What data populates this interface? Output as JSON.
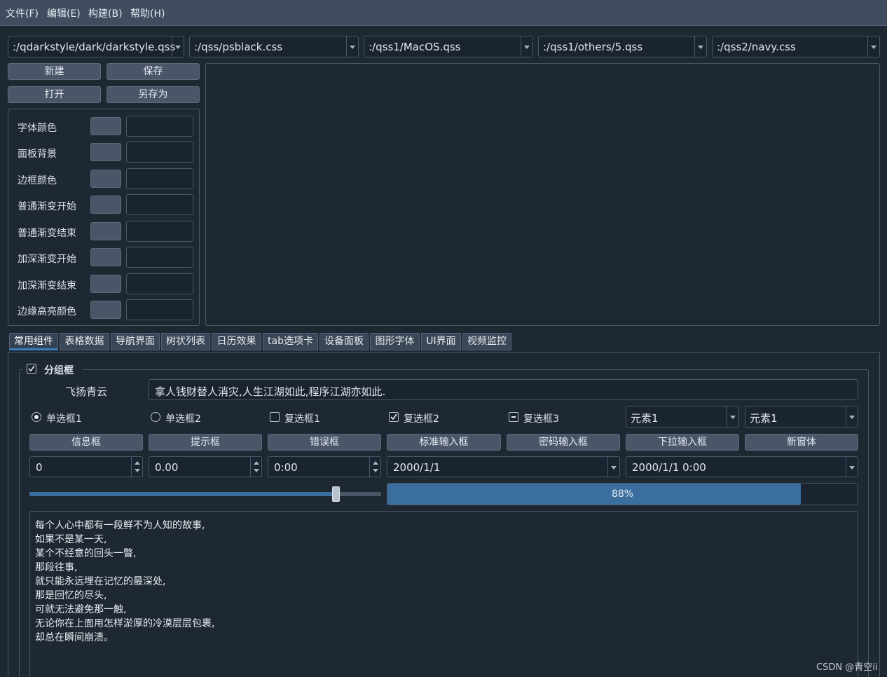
{
  "menu": [
    "文件(F)",
    "编辑(E)",
    "构建(B)",
    "帮助(H)"
  ],
  "style_combos": [
    ":/qdarkstyle/dark/darkstyle.qss",
    ":/qss/psblack.css",
    ":/qss1/MacOS.qss",
    ":/qss1/others/5.qss",
    ":/qss2/navy.css"
  ],
  "file_buttons": {
    "new": "新建",
    "save": "保存",
    "open": "打开",
    "save_as": "另存为"
  },
  "color_rows": [
    "字体颜色",
    "面板背景",
    "边框颜色",
    "普通渐变开始",
    "普通渐变结束",
    "加深渐变开始",
    "加深渐变结束",
    "边缘高亮颜色"
  ],
  "tabs": [
    "常用组件",
    "表格数据",
    "导航界面",
    "树状列表",
    "日历效果",
    "tab选项卡",
    "设备面板",
    "图形字体",
    "UI界面",
    "视频监控"
  ],
  "groupbox": {
    "title": "分组框",
    "checked": true
  },
  "line_label": "飞扬青云",
  "line_value": "拿人钱财替人消灾,人生江湖如此,程序江湖亦如此.",
  "radios": [
    "单选框1",
    "单选框2"
  ],
  "checkboxes": [
    "复选框1",
    "复选框2",
    "复选框3"
  ],
  "combo_elements": [
    "元素1",
    "元素1"
  ],
  "dialog_buttons": [
    "信息框",
    "提示框",
    "错误框",
    "标准输入框",
    "密码输入框",
    "下拉输入框",
    "新窗体"
  ],
  "spin_values": [
    "0",
    "0.00",
    "0:00"
  ],
  "date_value": "2000/1/1",
  "datetime_value": "2000/1/1 0:00",
  "slider_value": 0.87,
  "progress": {
    "value": 88,
    "label": "88%"
  },
  "text_lines": [
    "每个人心中都有一段鲜不为人知的故事,",
    "如果不是某一天,",
    "某个不经意的回头一瞥,",
    "那段往事,",
    "就只能永远埋在记忆的最深处,",
    "那是回忆的尽头,",
    "可就无法避免那一触,",
    "无论你在上面用怎样淤厚的冷漠层层包裹,",
    "却总在瞬间崩溃。"
  ],
  "watermark": "CSDN @青空ii",
  "colors": {
    "accent": "#3a6e9e",
    "bg": "#1e2833",
    "menubar": "#3f4d5f"
  }
}
